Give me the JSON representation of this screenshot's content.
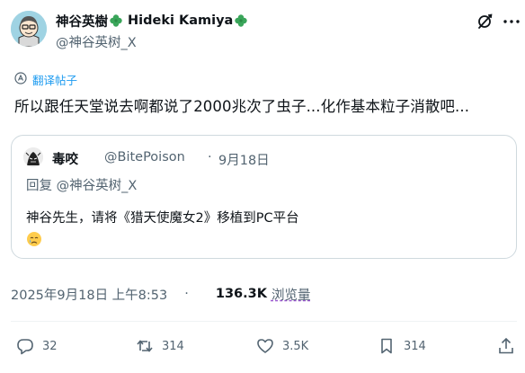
{
  "author": {
    "display_name": "神谷英樹",
    "display_name_en": "Hideki Kamiya",
    "handle": "@神谷英树_X"
  },
  "translate_label": "翻译帖子",
  "post_text": "所以跟任天堂说去啊都说了2000兆次了虫子...化作基本粒子消散吧...",
  "quote": {
    "name": "毒咬",
    "handle": "@BitePoison",
    "dot": "·",
    "date": "9月18日",
    "reply_to": "回复 @神谷英树_X",
    "text": "神谷先生，请将《猎天使魔女2》移植到PC平台"
  },
  "meta": {
    "timestamp": "2025年9月18日 上午8:53",
    "dot": "·",
    "views": "136.3K",
    "views_label": "浏览量"
  },
  "actions": {
    "replies": "32",
    "reposts": "314",
    "likes": "3.5K",
    "bookmarks": "314"
  },
  "colors": {
    "accent": "#1d9bf0",
    "muted": "#536471",
    "border": "#cfd9de",
    "clover": "#3aa55a"
  },
  "icons": [
    "clover-icon",
    "grok-icon",
    "more-icon",
    "translate-icon",
    "reply-icon",
    "repost-icon",
    "like-icon",
    "bookmark-icon",
    "share-icon",
    "crying-face-emoji"
  ]
}
